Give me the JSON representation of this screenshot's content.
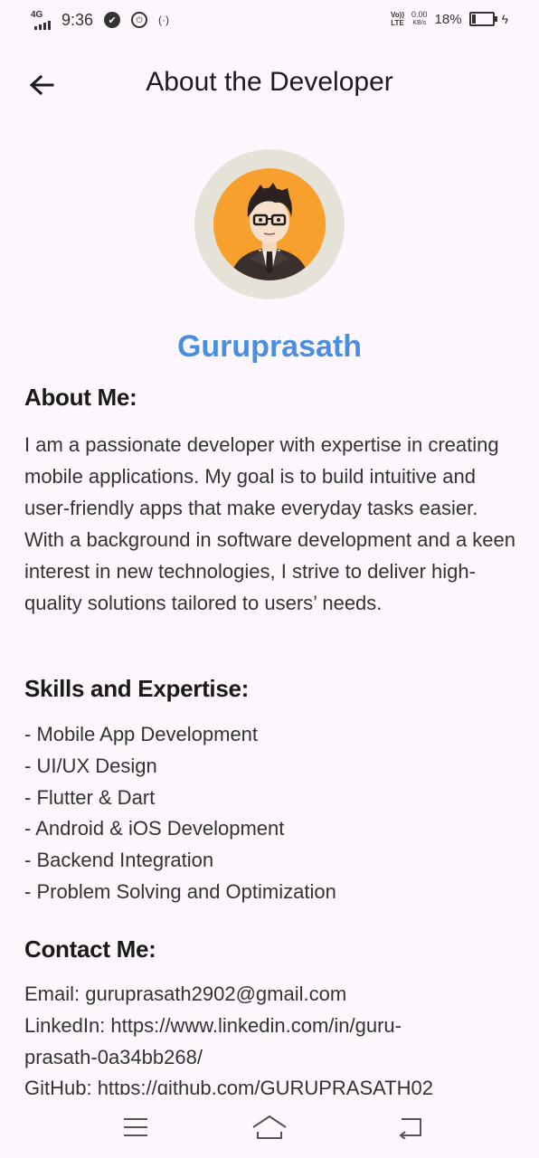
{
  "status_bar": {
    "network": "4G",
    "time": "9:36",
    "volte_line1": "Vo))",
    "volte_line2": "LTE",
    "speed_value": "0.00",
    "speed_unit": "KB/s",
    "battery_percent": "18%",
    "battery_level": 0.18
  },
  "app_bar": {
    "back_icon": "arrow-left-icon",
    "title": "About the Developer"
  },
  "profile": {
    "avatar_icon": "developer-avatar-icon",
    "name": "Guruprasath",
    "name_color": "#4a8ee0",
    "avatar_bg": "#f7a02e",
    "avatar_ring": "#e5e2d8"
  },
  "about": {
    "heading": "About Me:",
    "text": "I am a passionate developer with expertise in creating mobile applications. My goal is to build intuitive and user-friendly apps that make everyday tasks easier. With a background in software development and a keen interest in new technologies, I strive to deliver high-quality solutions tailored to users’ needs."
  },
  "skills": {
    "heading": "Skills and Expertise:",
    "items": [
      "- Mobile App Development",
      "- UI/UX Design",
      "- Flutter & Dart",
      "- Android & iOS Development",
      "- Backend Integration",
      "- Problem Solving and Optimization"
    ]
  },
  "contact": {
    "heading": "Contact Me:",
    "email": "Email: guruprasath2902@gmail.com",
    "linkedin_line1": "LinkedIn: https://www.linkedin.com/in/guru-",
    "linkedin_line2": "prasath-0a34bb268/",
    "github": "GitHub: https://github.com/GURUPRASATH02"
  },
  "nav_bar": {
    "menu_icon": "menu-icon",
    "home_icon": "home-icon",
    "back_icon": "back-nav-icon"
  },
  "colors": {
    "background": "#fdf7fd",
    "text": "#333333"
  }
}
